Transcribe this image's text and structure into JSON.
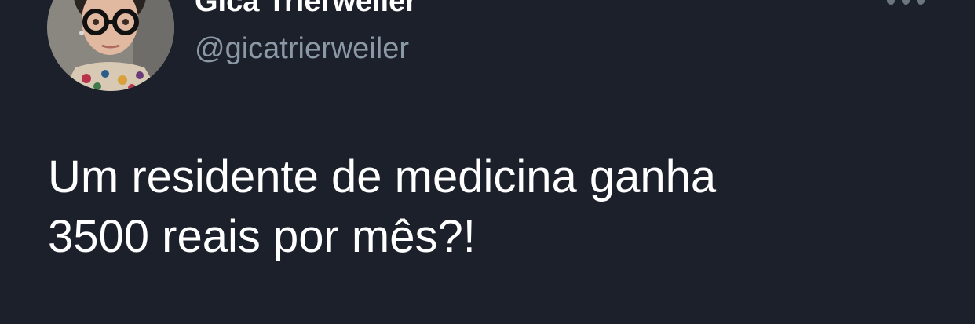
{
  "author": {
    "display_name": "Gica Trierweiler",
    "handle": "@gicatrierweiler",
    "avatar_icon": "profile-photo"
  },
  "menu": {
    "icon": "more-options-icon"
  },
  "tweet": {
    "text_lines": [
      "Um residente de medicina ganha",
      "3500 reais por mês?!"
    ]
  },
  "colors": {
    "background": "#1b202b",
    "text": "#ffffff",
    "secondary_text": "#8b98a5"
  }
}
